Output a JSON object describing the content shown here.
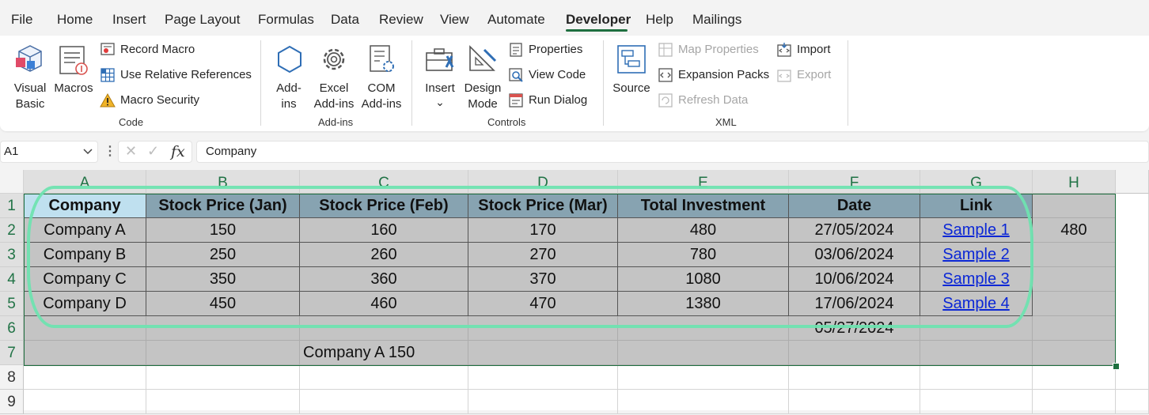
{
  "menu": {
    "items": [
      "File",
      "Home",
      "Insert",
      "Page Layout",
      "Formulas",
      "Data",
      "Review",
      "View",
      "Automate",
      "Developer",
      "Help",
      "Mailings"
    ],
    "active": "Developer",
    "accent_color": "#1e6f3f"
  },
  "ribbon": {
    "code": {
      "group_label": "Code",
      "visual_basic": [
        "Visual",
        "Basic"
      ],
      "macros": "Macros",
      "record_macro": "Record Macro",
      "use_relative_references": "Use Relative References",
      "macro_security": "Macro Security"
    },
    "addins": {
      "group_label": "Add-ins",
      "addins": [
        "Add-",
        "ins"
      ],
      "excel_addins": [
        "Excel",
        "Add-ins"
      ],
      "com_addins": [
        "COM",
        "Add-ins"
      ]
    },
    "controls": {
      "group_label": "Controls",
      "insert": "Insert",
      "insert_chevron": "⌄",
      "design_mode": [
        "Design",
        "Mode"
      ],
      "properties": "Properties",
      "view_code": "View Code",
      "run_dialog": "Run Dialog"
    },
    "xml": {
      "group_label": "XML",
      "source": "Source",
      "map_properties": "Map Properties",
      "expansion_packs": "Expansion Packs",
      "refresh_data": "Refresh Data",
      "import": "Import",
      "export": "Export"
    }
  },
  "formula_bar": {
    "name_box": "A1",
    "cancel_icon": "✕",
    "enter_icon": "✓",
    "fx": "fx",
    "content": "Company"
  },
  "sheet": {
    "columns": [
      "A",
      "B",
      "C",
      "D",
      "E",
      "F",
      "G",
      "H"
    ],
    "rows": [
      "1",
      "2",
      "3",
      "4",
      "5",
      "6",
      "7",
      "8",
      "9"
    ],
    "headers": [
      "Company",
      "Stock Price (Jan)",
      "Stock Price (Feb)",
      "Stock Price (Mar)",
      "Total Investment",
      "Date",
      "Link"
    ],
    "data": [
      [
        "Company A",
        "150",
        "160",
        "170",
        "480",
        "27/05/2024",
        "Sample 1"
      ],
      [
        "Company B",
        "250",
        "260",
        "270",
        "780",
        "03/06/2024",
        "Sample 2"
      ],
      [
        "Company C",
        "350",
        "360",
        "370",
        "1080",
        "10/06/2024",
        "Sample 3"
      ],
      [
        "Company D",
        "450",
        "460",
        "470",
        "1380",
        "17/06/2024",
        "Sample 4"
      ]
    ],
    "h2": "480",
    "f6": "05/27/2024",
    "c7": "Company A 150",
    "colors": {
      "header_fill": "#87a3b1",
      "header_a1_fill": "#bfe0ef",
      "selection_fill": "#c4c4c4",
      "link": "#0b27d6",
      "highlight_outline": "#6fe3b0"
    }
  }
}
